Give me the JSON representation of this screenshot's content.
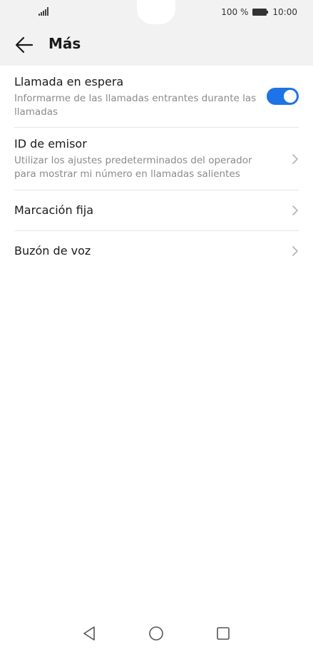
{
  "status_bar": {
    "battery_percent": "100 %",
    "time": "10:00",
    "icons": [
      "signal-icon",
      "battery-icon"
    ]
  },
  "app_bar": {
    "title": "Más",
    "back_icon": "arrow-left-icon"
  },
  "settings": {
    "items": [
      {
        "title": "Llamada en espera",
        "subtitle": "Informarme de las llamadas entrantes durante las llamadas",
        "control": "toggle",
        "toggle_on": true
      },
      {
        "title": "ID de emisor",
        "subtitle": "Utilizar los ajustes predeterminados del operador para mostrar mi número en llamadas salientes",
        "control": "chevron"
      },
      {
        "title": "Marcación fija",
        "control": "chevron"
      },
      {
        "title": "Buzón de voz",
        "control": "chevron"
      }
    ]
  },
  "nav_bar": {
    "icons": [
      "nav-back-icon",
      "nav-home-icon",
      "nav-recents-icon"
    ]
  },
  "colors": {
    "accent": "#1e73e6",
    "header_bg": "#f2f2f2",
    "subtitle_text": "#8a8a8a",
    "divider": "#e6e6e6"
  }
}
